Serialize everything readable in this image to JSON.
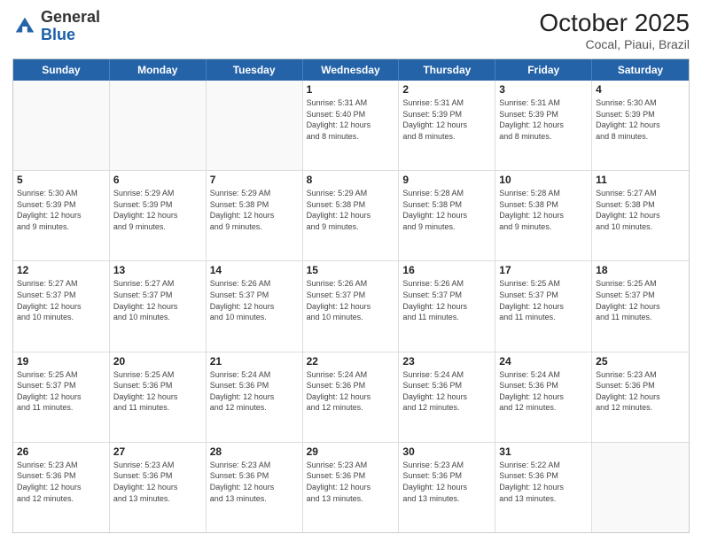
{
  "header": {
    "logo_general": "General",
    "logo_blue": "Blue",
    "month_title": "October 2025",
    "location": "Cocal, Piaui, Brazil"
  },
  "day_headers": [
    "Sunday",
    "Monday",
    "Tuesday",
    "Wednesday",
    "Thursday",
    "Friday",
    "Saturday"
  ],
  "weeks": [
    [
      {
        "day": "",
        "info": ""
      },
      {
        "day": "",
        "info": ""
      },
      {
        "day": "",
        "info": ""
      },
      {
        "day": "1",
        "info": "Sunrise: 5:31 AM\nSunset: 5:40 PM\nDaylight: 12 hours\nand 8 minutes."
      },
      {
        "day": "2",
        "info": "Sunrise: 5:31 AM\nSunset: 5:39 PM\nDaylight: 12 hours\nand 8 minutes."
      },
      {
        "day": "3",
        "info": "Sunrise: 5:31 AM\nSunset: 5:39 PM\nDaylight: 12 hours\nand 8 minutes."
      },
      {
        "day": "4",
        "info": "Sunrise: 5:30 AM\nSunset: 5:39 PM\nDaylight: 12 hours\nand 8 minutes."
      }
    ],
    [
      {
        "day": "5",
        "info": "Sunrise: 5:30 AM\nSunset: 5:39 PM\nDaylight: 12 hours\nand 9 minutes."
      },
      {
        "day": "6",
        "info": "Sunrise: 5:29 AM\nSunset: 5:39 PM\nDaylight: 12 hours\nand 9 minutes."
      },
      {
        "day": "7",
        "info": "Sunrise: 5:29 AM\nSunset: 5:38 PM\nDaylight: 12 hours\nand 9 minutes."
      },
      {
        "day": "8",
        "info": "Sunrise: 5:29 AM\nSunset: 5:38 PM\nDaylight: 12 hours\nand 9 minutes."
      },
      {
        "day": "9",
        "info": "Sunrise: 5:28 AM\nSunset: 5:38 PM\nDaylight: 12 hours\nand 9 minutes."
      },
      {
        "day": "10",
        "info": "Sunrise: 5:28 AM\nSunset: 5:38 PM\nDaylight: 12 hours\nand 9 minutes."
      },
      {
        "day": "11",
        "info": "Sunrise: 5:27 AM\nSunset: 5:38 PM\nDaylight: 12 hours\nand 10 minutes."
      }
    ],
    [
      {
        "day": "12",
        "info": "Sunrise: 5:27 AM\nSunset: 5:37 PM\nDaylight: 12 hours\nand 10 minutes."
      },
      {
        "day": "13",
        "info": "Sunrise: 5:27 AM\nSunset: 5:37 PM\nDaylight: 12 hours\nand 10 minutes."
      },
      {
        "day": "14",
        "info": "Sunrise: 5:26 AM\nSunset: 5:37 PM\nDaylight: 12 hours\nand 10 minutes."
      },
      {
        "day": "15",
        "info": "Sunrise: 5:26 AM\nSunset: 5:37 PM\nDaylight: 12 hours\nand 10 minutes."
      },
      {
        "day": "16",
        "info": "Sunrise: 5:26 AM\nSunset: 5:37 PM\nDaylight: 12 hours\nand 11 minutes."
      },
      {
        "day": "17",
        "info": "Sunrise: 5:25 AM\nSunset: 5:37 PM\nDaylight: 12 hours\nand 11 minutes."
      },
      {
        "day": "18",
        "info": "Sunrise: 5:25 AM\nSunset: 5:37 PM\nDaylight: 12 hours\nand 11 minutes."
      }
    ],
    [
      {
        "day": "19",
        "info": "Sunrise: 5:25 AM\nSunset: 5:37 PM\nDaylight: 12 hours\nand 11 minutes."
      },
      {
        "day": "20",
        "info": "Sunrise: 5:25 AM\nSunset: 5:36 PM\nDaylight: 12 hours\nand 11 minutes."
      },
      {
        "day": "21",
        "info": "Sunrise: 5:24 AM\nSunset: 5:36 PM\nDaylight: 12 hours\nand 12 minutes."
      },
      {
        "day": "22",
        "info": "Sunrise: 5:24 AM\nSunset: 5:36 PM\nDaylight: 12 hours\nand 12 minutes."
      },
      {
        "day": "23",
        "info": "Sunrise: 5:24 AM\nSunset: 5:36 PM\nDaylight: 12 hours\nand 12 minutes."
      },
      {
        "day": "24",
        "info": "Sunrise: 5:24 AM\nSunset: 5:36 PM\nDaylight: 12 hours\nand 12 minutes."
      },
      {
        "day": "25",
        "info": "Sunrise: 5:23 AM\nSunset: 5:36 PM\nDaylight: 12 hours\nand 12 minutes."
      }
    ],
    [
      {
        "day": "26",
        "info": "Sunrise: 5:23 AM\nSunset: 5:36 PM\nDaylight: 12 hours\nand 12 minutes."
      },
      {
        "day": "27",
        "info": "Sunrise: 5:23 AM\nSunset: 5:36 PM\nDaylight: 12 hours\nand 13 minutes."
      },
      {
        "day": "28",
        "info": "Sunrise: 5:23 AM\nSunset: 5:36 PM\nDaylight: 12 hours\nand 13 minutes."
      },
      {
        "day": "29",
        "info": "Sunrise: 5:23 AM\nSunset: 5:36 PM\nDaylight: 12 hours\nand 13 minutes."
      },
      {
        "day": "30",
        "info": "Sunrise: 5:23 AM\nSunset: 5:36 PM\nDaylight: 12 hours\nand 13 minutes."
      },
      {
        "day": "31",
        "info": "Sunrise: 5:22 AM\nSunset: 5:36 PM\nDaylight: 12 hours\nand 13 minutes."
      },
      {
        "day": "",
        "info": ""
      }
    ]
  ]
}
